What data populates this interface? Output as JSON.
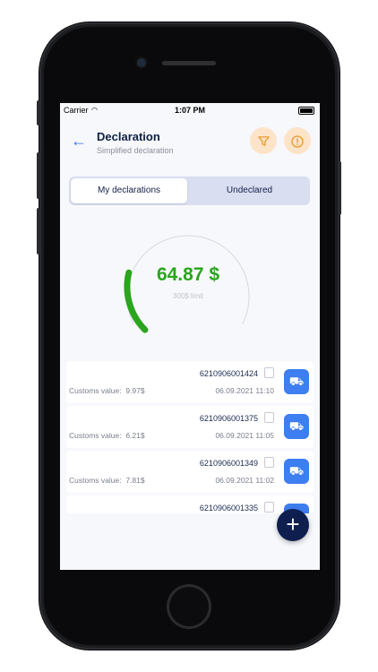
{
  "status": {
    "carrier": "Carrier",
    "wifi_icon": "wifi-icon",
    "time": "1:07 PM"
  },
  "header": {
    "title": "Declaration",
    "subtitle": "Simplified declaration",
    "back_icon": "arrow-left-icon",
    "filter_icon": "filter-icon",
    "info_icon": "info-icon"
  },
  "tabs": [
    {
      "label": "My declarations",
      "active": true
    },
    {
      "label": "Undeclared",
      "active": false
    }
  ],
  "gauge": {
    "amount": "64.87 $",
    "limit": "300$ limit",
    "progress": 0.216,
    "color": "#2aa51d"
  },
  "declarations": [
    {
      "number": "6210906001424",
      "customs_label": "Customs value:",
      "customs_value": "9.97$",
      "date": "06.09.2021 11:10"
    },
    {
      "number": "6210906001375",
      "customs_label": "Customs value:",
      "customs_value": "6.21$",
      "date": "06.09.2021 11:05"
    },
    {
      "number": "6210906001349",
      "customs_label": "Customs value:",
      "customs_value": "7.81$",
      "date": "06.09.2021 11:02"
    },
    {
      "number": "6210906001335"
    }
  ],
  "fab": {
    "label": "+"
  }
}
